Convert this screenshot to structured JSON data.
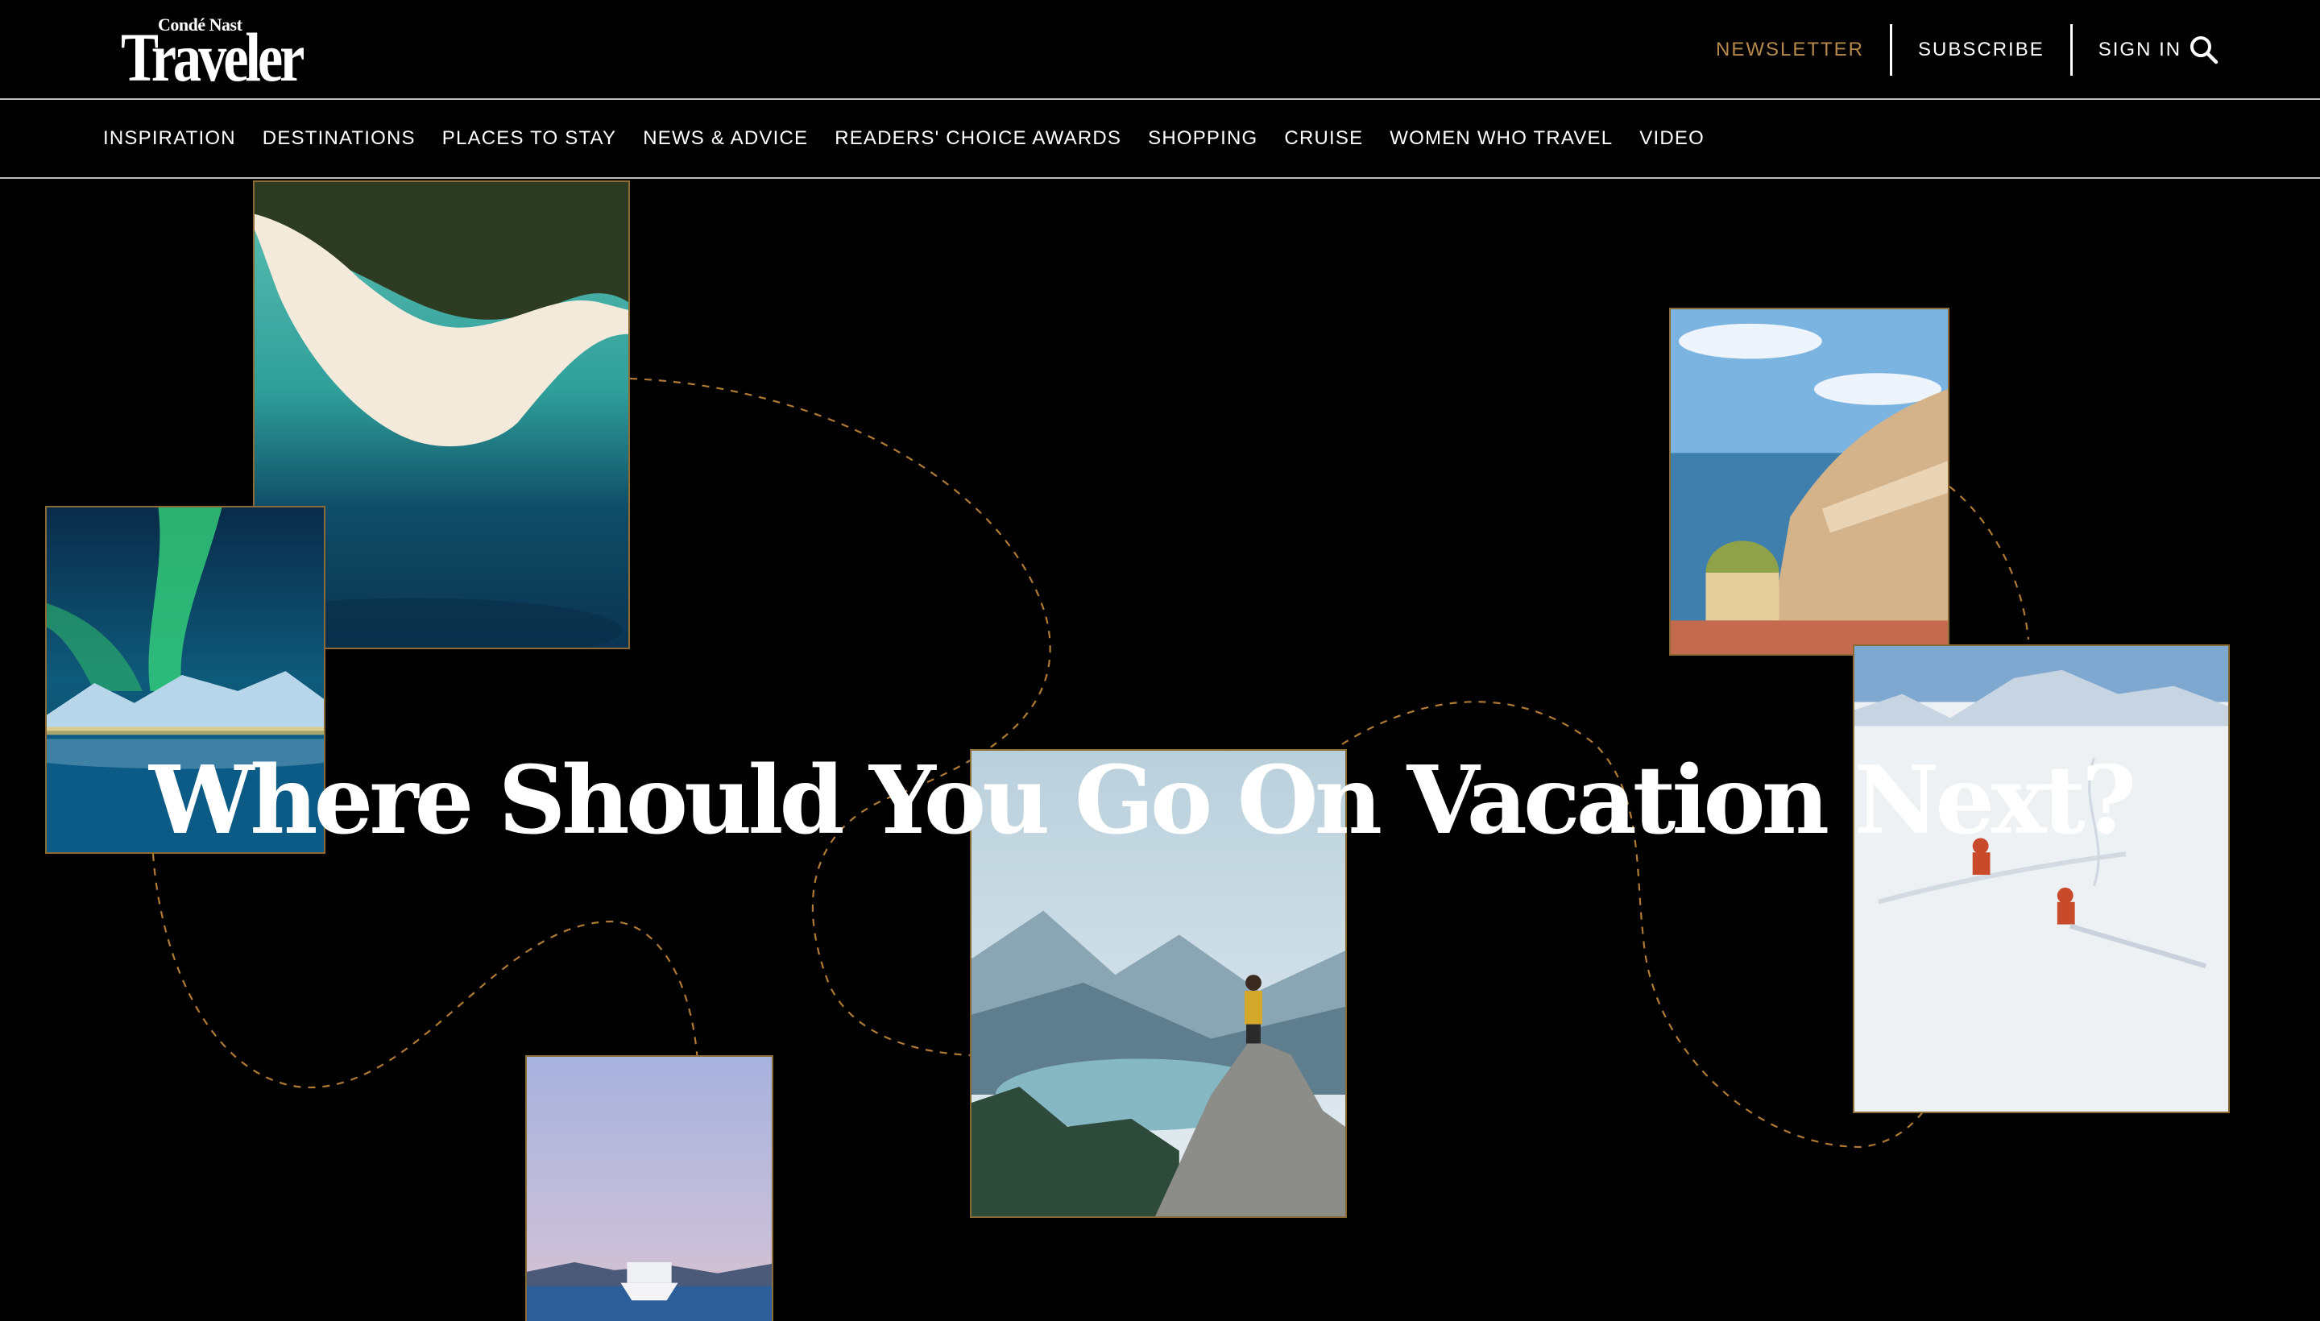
{
  "brand": {
    "small": "Condé Nast",
    "big": "Traveler"
  },
  "utility_nav": {
    "newsletter": "NEWSLETTER",
    "subscribe": "SUBSCRIBE",
    "sign_in": "SIGN IN",
    "search_icon": "search-icon"
  },
  "main_nav": [
    "INSPIRATION",
    "DESTINATIONS",
    "PLACES TO STAY",
    "NEWS & ADVICE",
    "READERS' CHOICE AWARDS",
    "SHOPPING",
    "CRUISE",
    "WOMEN WHO TRAVEL",
    "VIDEO"
  ],
  "hero": {
    "headline": "Where Should You Go On Vacation Next?",
    "photos": [
      "aerial-beach",
      "northern-lights",
      "amalfi-coast",
      "hiker-mountain-lake",
      "skiers",
      "cruise-ship"
    ]
  },
  "colors": {
    "background": "#000000",
    "accent_gold": "#b5894c",
    "photo_border": "#8a6a35",
    "divider": "#bdbdbd"
  }
}
